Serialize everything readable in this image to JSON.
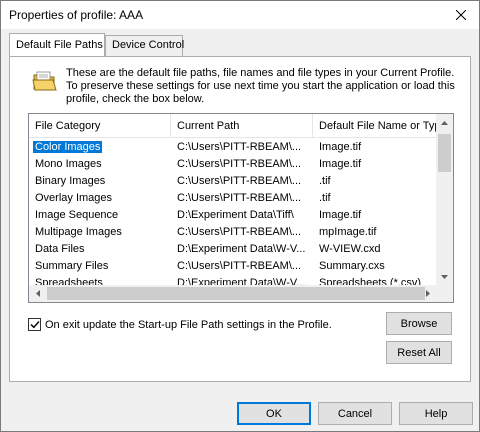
{
  "window": {
    "title": "Properties of profile: AAA"
  },
  "tabs": [
    {
      "label": "Default File Paths",
      "active": true
    },
    {
      "label": "Device Control",
      "active": false
    }
  ],
  "description": "These are the default file paths, file names and file types in your Current Profile. To preserve these settings for use next time you start the application or load this profile, check the box below.",
  "list": {
    "columns": [
      "File Category",
      "Current Path",
      "Default File Name or Typ"
    ],
    "rows": [
      {
        "category": "Color Images",
        "path": "C:\\Users\\PITT-RBEAM\\...",
        "name": "Image.tif",
        "selected": true
      },
      {
        "category": "Mono Images",
        "path": "C:\\Users\\PITT-RBEAM\\...",
        "name": "Image.tif",
        "selected": false
      },
      {
        "category": "Binary Images",
        "path": "C:\\Users\\PITT-RBEAM\\...",
        "name": ".tif",
        "selected": false
      },
      {
        "category": "Overlay Images",
        "path": "C:\\Users\\PITT-RBEAM\\...",
        "name": ".tif",
        "selected": false
      },
      {
        "category": "Image Sequence",
        "path": "D:\\Experiment Data\\Tiff\\",
        "name": "Image.tif",
        "selected": false
      },
      {
        "category": "Multipage Images",
        "path": "C:\\Users\\PITT-RBEAM\\...",
        "name": "mpImage.tif",
        "selected": false
      },
      {
        "category": "Data Files",
        "path": "D:\\Experiment Data\\W-V...",
        "name": "W-VIEW.cxd",
        "selected": false
      },
      {
        "category": "Summary Files",
        "path": "C:\\Users\\PITT-RBEAM\\...",
        "name": "Summary.cxs",
        "selected": false
      },
      {
        "category": "Spreadsheets",
        "path": "D:\\Experiment Data\\W-V...",
        "name": "Spreadsheets (*.csv)",
        "selected": false
      }
    ]
  },
  "checkbox": {
    "label": "On exit update the Start-up File Path settings in the Profile.",
    "checked": true
  },
  "buttons": {
    "browse": "Browse",
    "reset_all": "Reset All",
    "ok": "OK",
    "cancel": "Cancel",
    "help": "Help"
  },
  "colors": {
    "selection": "#0078d7",
    "folder": "#f2c94c"
  },
  "icons": {
    "close": "close-icon",
    "folder": "open-folder-icon"
  }
}
